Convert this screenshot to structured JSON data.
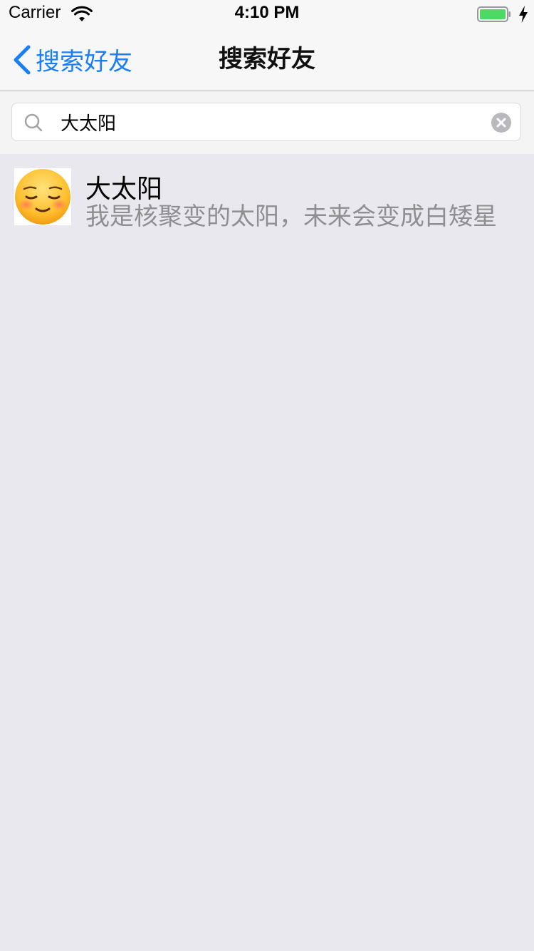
{
  "status_bar": {
    "carrier": "Carrier",
    "time": "4:10 PM",
    "battery_color": "#4cd964",
    "icons": [
      "wifi-icon",
      "battery-icon",
      "charging-icon"
    ]
  },
  "nav": {
    "back_label": "搜索好友",
    "title": "搜索好友",
    "accent_color": "#1a7ef6"
  },
  "search": {
    "value": "大太阳",
    "placeholder": "",
    "icons": [
      "search-icon",
      "clear-icon"
    ]
  },
  "results": [
    {
      "name": "大太阳",
      "signature": "我是核聚变的太阳，未来会变成白矮星",
      "avatar_icon": "relieved-face-emoji-icon"
    }
  ]
}
